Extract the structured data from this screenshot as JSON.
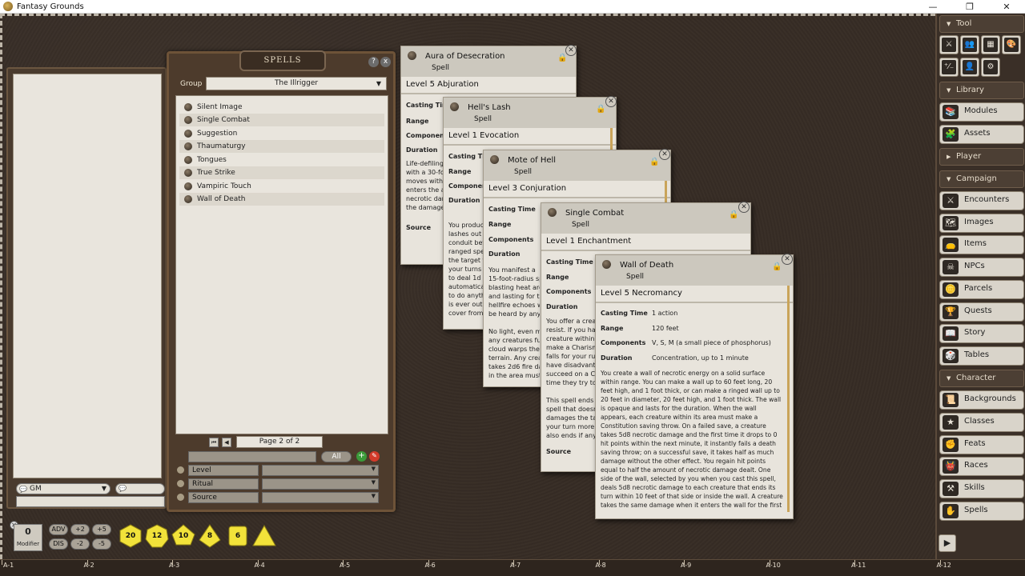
{
  "window": {
    "title": "Fantasy Grounds",
    "controls": [
      "—",
      "❐",
      "✕"
    ]
  },
  "chat": {
    "identity": "GM"
  },
  "spells_window": {
    "title": "SPELLS",
    "help": "?",
    "close": "x",
    "group_label": "Group",
    "group_value": "The Illrigger",
    "items": [
      "Silent Image",
      "Single Combat",
      "Suggestion",
      "Thaumaturgy",
      "Tongues",
      "True Strike",
      "Vampiric Touch",
      "Wall of Death"
    ],
    "page_label": "Page 2 of 2",
    "all_label": "All",
    "filters": [
      "Level",
      "Ritual",
      "Source"
    ]
  },
  "cards": [
    {
      "name": "Aura of Desecration",
      "sub": "Spell",
      "school": "Level 5 Abjuration",
      "labels": [
        "Casting Tim",
        "Range",
        "Component",
        "Duration"
      ],
      "desc": "Life-defiling\nwith a 30-fo\nmoves with\nenters the a\nnecrotic dar\nthe damage",
      "source": "Source"
    },
    {
      "name": "Hell's Lash",
      "sub": "Spell",
      "school": "Level 1 Evocation",
      "labels": [
        "Casting Tim",
        "Range",
        "Componen",
        "Duration"
      ],
      "desc": "You produc\nlashes out\nconduit bet\nranged spe\nthe target t\nyour turns\nto deal 1d\nautomatica\nto do anyth\nis ever out\ncover from",
      "source": "Source"
    },
    {
      "name": "Mote of Hell",
      "sub": "Spell",
      "school": "Level 3 Conjuration",
      "labels": [
        "Casting Time",
        "Range",
        "Components",
        "Duration"
      ],
      "desc": "You manifest a\n15-foot-radius sp\nblasting heat are\nand lasting for th\nhellfire echoes w\nbe heard by any\n\nNo light, even m\nany creatures fu\ncloud warps the\nterrain. Any crea\ntakes 2d6 fire da\nin the area must",
      "source": ""
    },
    {
      "name": "Single Combat",
      "sub": "Spell",
      "school": "Level 1 Enchantment",
      "labels": [
        "Casting Time",
        "Range",
        "Components",
        "Duration"
      ],
      "desc": "You offer a crea\nresist. If you hav\ncreature within\nmake a Charism\nfalls for your ru\nhave disadvanta\nsucceed on a Ch\ntime they try to\n\nThis spell ends i\nspell that doesn\ndamages the ta\nyour turn more\nalso ends if any",
      "source": "Source"
    },
    {
      "name": "Wall of Death",
      "sub": "Spell",
      "school": "Level 5 Necromancy",
      "labels": [
        "Casting Time",
        "Range",
        "Components",
        "Duration"
      ],
      "values": [
        "1 action",
        "120 feet",
        "V, S, M (a small piece of phosphorus)",
        "Concentration, up to 1 minute"
      ],
      "desc": "You create a wall of necrotic energy on a solid surface\nwithin range. You can make a wall up to 60 feet long, 20\nfeet high, and 1 foot thick, or can make a ringed wall up to\n20 feet in diameter, 20 feet high, and 1 foot thick. The wall\nis opaque and lasts for the duration. When the wall\nappears, each creature within its area must make a\nConstitution saving throw. On a failed save, a creature\ntakes 5d8 necrotic damage and the first time it drops to 0\nhit points within the next minute, it instantly fails a death\nsaving throw; on a successful save, it takes half as much\ndamage without the other effect. You regain hit points\nequal to half the amount of necrotic damage dealt. One\nside of the wall, selected by you when you cast this spell,\ndeals 5d8 necrotic damage to each creature that ends its\nturn within 10 feet of that side or inside the wall. A creature\ntakes the same damage when it enters the wall for the first"
    }
  ],
  "sidebar": {
    "sections": {
      "tool": "Tool",
      "library": "Library",
      "player": "Player",
      "campaign": "Campaign",
      "character": "Character"
    },
    "tool_icons": [
      "crossed-swords-icon",
      "people-icon",
      "calendar-icon",
      "palette-icon",
      "dice-ratio-icon",
      "users-icon",
      "gear-icon"
    ],
    "library_items": [
      "Modules",
      "Assets"
    ],
    "campaign_items": [
      "Encounters",
      "Images",
      "Items",
      "NPCs",
      "Parcels",
      "Quests",
      "Story",
      "Tables"
    ],
    "character_items": [
      "Backgrounds",
      "Classes",
      "Feats",
      "Races",
      "Skills",
      "Spells"
    ]
  },
  "modifier": {
    "value": "0",
    "label": "Modifier",
    "chips": [
      "ADV",
      "+2",
      "+5",
      "DIS",
      "-2",
      "-5"
    ]
  },
  "dice": [
    "20",
    "12",
    "10",
    "8",
    "6",
    "4"
  ],
  "hotbar": [
    "A-1",
    "A-2",
    "A-3",
    "A-4",
    "A-5",
    "A-6",
    "A-7",
    "A-8",
    "A-9",
    "A-10",
    "A-11",
    "A-12"
  ],
  "colors": {
    "leather": "#362c25",
    "paper": "#e9e5dd",
    "die_yellow": "#f2e23a",
    "accent_gold": "#c9a45a"
  }
}
